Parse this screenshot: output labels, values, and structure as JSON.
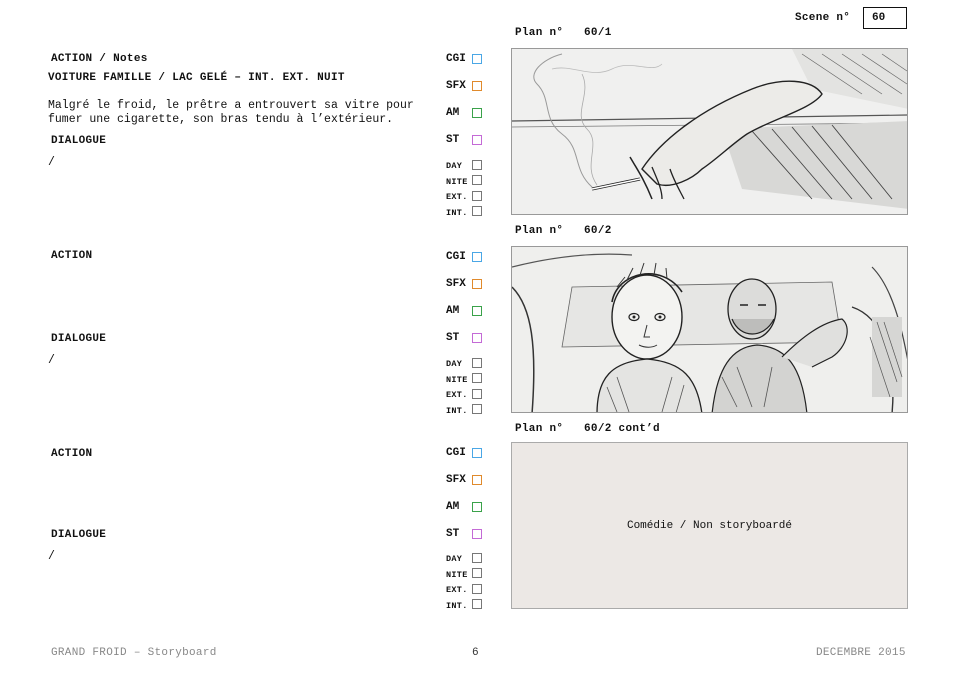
{
  "header": {
    "scene_label": "Scene n°",
    "scene_number": "60"
  },
  "colors": {
    "cgi": "#4aa7e6",
    "sfx": "#e08a2c",
    "am": "#3aa24a",
    "st": "#c46ad6"
  },
  "checkbox_labels": {
    "cgi": "CGI",
    "sfx": "SFX",
    "am": "AM",
    "st": "ST",
    "day": "DAY",
    "nite": "NITE",
    "ext": "EXT.",
    "int": "INT."
  },
  "panels": [
    {
      "plan_label": "Plan n°",
      "plan_number": "60/1",
      "action_label": "ACTION / Notes",
      "heading": "VOITURE FAMILLE / LAC GELÉ – INT. EXT. NUIT",
      "action_line1": "Malgré le froid, le prêtre a entrouvert sa vitre pour",
      "action_line2": "fumer une cigarette, son bras tendu à l’extérieur.",
      "dialogue_label": "DIALOGUE",
      "dialogue": "/"
    },
    {
      "plan_label": "Plan n°",
      "plan_number": "60/2",
      "action_label": "ACTION",
      "dialogue_label": "DIALOGUE",
      "dialogue": "/"
    },
    {
      "plan_label": "Plan n°",
      "plan_number": "60/2 cont’d",
      "action_label": "ACTION",
      "dialogue_label": "DIALOGUE",
      "dialogue": "/",
      "frame_text": "Comédie / Non storyboardé"
    }
  ],
  "footer": {
    "left": "GRAND FROID – Storyboard",
    "page": "6",
    "right": "DECEMBRE 2015"
  }
}
